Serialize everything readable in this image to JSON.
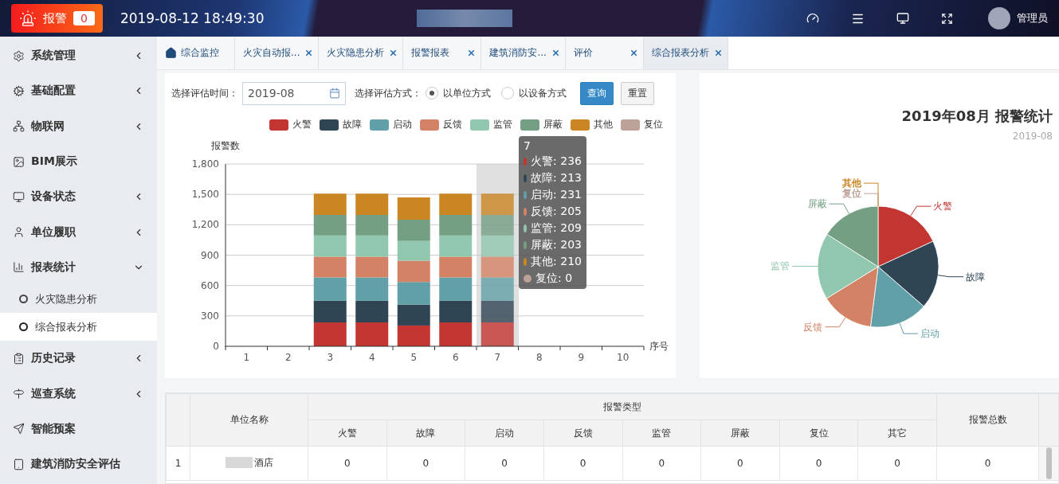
{
  "header": {
    "alarm_button": {
      "label": "报警",
      "count": "0"
    },
    "datetime": "2019-08-12 18:49:30",
    "user": "管理员"
  },
  "sidebar": {
    "items": [
      {
        "label": "系统管理",
        "expanded": false
      },
      {
        "label": "基础配置",
        "expanded": false
      },
      {
        "label": "物联网",
        "expanded": false
      },
      {
        "label": "BIM展示"
      },
      {
        "label": "设备状态",
        "expanded": false
      },
      {
        "label": "单位履职",
        "expanded": false
      },
      {
        "label": "报表统计",
        "expanded": true,
        "children": [
          {
            "label": "火灾隐患分析",
            "selected": false
          },
          {
            "label": "综合报表分析",
            "selected": true
          }
        ]
      },
      {
        "label": "历史记录",
        "expanded": false
      },
      {
        "label": "巡查系统",
        "expanded": false
      },
      {
        "label": "智能预案"
      },
      {
        "label": "建筑消防安全评估"
      }
    ]
  },
  "tabs": [
    {
      "label": "综合监控",
      "selected": false,
      "closable": false
    },
    {
      "label": "火灾自动报...",
      "selected": false,
      "closable": true
    },
    {
      "label": "火灾隐患分析",
      "selected": false,
      "closable": true
    },
    {
      "label": "报警报表",
      "selected": false,
      "closable": true
    },
    {
      "label": "建筑消防安...",
      "selected": false,
      "closable": true
    },
    {
      "label": "评价",
      "selected": false,
      "closable": true
    },
    {
      "label": "综合报表分析",
      "selected": true,
      "closable": true
    }
  ],
  "filter": {
    "time_label": "选择评估时间：",
    "time_value": "2019-08",
    "method_label": "选择评估方式：",
    "methods": [
      {
        "label": "以单位方式",
        "selected": true
      },
      {
        "label": "以设备方式",
        "selected": false
      }
    ],
    "buttons": [
      {
        "label": "查询",
        "kind": "primary"
      },
      {
        "label": "重置",
        "kind": "default"
      }
    ]
  },
  "bar_chart": {
    "chart_data": {
      "type": "bar",
      "stacked": true,
      "grid": true,
      "xlabel": "序号",
      "ylabel": "报警数",
      "categories": [
        "1",
        "2",
        "3",
        "4",
        "5",
        "6",
        "7",
        "8",
        "9",
        "10"
      ],
      "yticks": [
        0,
        {
          "value": 300,
          "label": "300"
        },
        {
          "value": 600,
          "label": "600"
        },
        {
          "value": 900,
          "label": "900"
        },
        {
          "value": 1200,
          "label": "1,200"
        },
        {
          "value": 1500,
          "label": "1,500"
        },
        {
          "value": 1800,
          "label": "1,800"
        }
      ],
      "ylim": [
        0,
        1800
      ],
      "series": [
        {
          "name": "火警",
          "color": "#c23531",
          "values": [
            0,
            0,
            236,
            236,
            205,
            236,
            236,
            0,
            0,
            0
          ]
        },
        {
          "name": "故障",
          "color": "#2f4554",
          "values": [
            0,
            0,
            213,
            213,
            205,
            213,
            213,
            0,
            0,
            0
          ]
        },
        {
          "name": "启动",
          "color": "#61a0a8",
          "values": [
            0,
            0,
            231,
            231,
            225,
            231,
            231,
            0,
            0,
            0
          ]
        },
        {
          "name": "反馈",
          "color": "#d48265",
          "values": [
            0,
            0,
            205,
            205,
            210,
            205,
            205,
            0,
            0,
            0
          ]
        },
        {
          "name": "监管",
          "color": "#91c7ae",
          "values": [
            0,
            0,
            209,
            209,
            195,
            209,
            209,
            0,
            0,
            0
          ]
        },
        {
          "name": "屏蔽",
          "color": "#749f83",
          "values": [
            0,
            0,
            203,
            203,
            210,
            203,
            203,
            0,
            0,
            0
          ]
        },
        {
          "name": "其他",
          "color": "#ca8622",
          "values": [
            0,
            0,
            210,
            210,
            220,
            210,
            210,
            0,
            0,
            0
          ]
        },
        {
          "name": "复位",
          "color": "#bda29a",
          "values": [
            0,
            0,
            0,
            0,
            0,
            0,
            0,
            0,
            0,
            0
          ]
        }
      ]
    },
    "tooltip": {
      "title": "7",
      "items": [
        {
          "text": "火警: 236",
          "color": "#c23531"
        },
        {
          "text": "故障: 213",
          "color": "#2f4554"
        },
        {
          "text": "启动: 231",
          "color": "#61a0a8"
        },
        {
          "text": "反馈: 205",
          "color": "#d48265"
        },
        {
          "text": "监管: 209",
          "color": "#91c7ae"
        },
        {
          "text": "屏蔽: 203",
          "color": "#749f83"
        },
        {
          "text": "其他: 210",
          "color": "#ca8622"
        },
        {
          "text": "复位: 0",
          "color": "#bda29a"
        }
      ]
    }
  },
  "pie_chart": {
    "title": "2019年08月 报警统计",
    "subtitle": "2019-08",
    "chart_data": {
      "type": "pie",
      "categories": [
        "火警",
        "故障",
        "启动",
        "反馈",
        "监管",
        "屏蔽",
        "复位",
        "其他"
      ],
      "values": [
        18.1,
        18.3,
        15.6,
        14.2,
        17.8,
        16.0,
        0,
        0
      ]
    },
    "slices": [
      {
        "color": "#c23531"
      },
      {
        "color": "#2f4554"
      },
      {
        "color": "#61a0a8"
      },
      {
        "color": "#d48265"
      },
      {
        "color": "#91c7ae"
      },
      {
        "color": "#749f83"
      },
      {
        "color": "#bda29a"
      },
      {
        "color": "#ca8622"
      }
    ]
  },
  "table": {
    "name_header": "单位名称",
    "group_header": "报警类型",
    "total_header": "报警总数",
    "columns": [
      "火警",
      "故障",
      "启动",
      "反馈",
      "监管",
      "屏蔽",
      "复位",
      "其它"
    ],
    "rows": [
      {
        "index": "1",
        "name": "酒店",
        "values": [
          "0",
          "0",
          "0",
          "0",
          "0",
          "0",
          "0",
          "0"
        ],
        "total": "0"
      }
    ]
  }
}
